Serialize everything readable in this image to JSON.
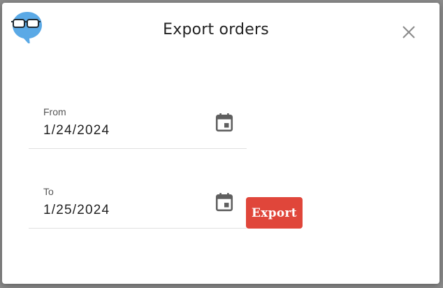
{
  "dialog": {
    "title": "Export orders",
    "close_icon": "close-icon",
    "logo_icon": "glasses-speech-bubble-logo"
  },
  "form": {
    "from": {
      "label": "From",
      "value": "1/24/2024",
      "icon": "calendar-icon"
    },
    "to": {
      "label": "To",
      "value": "1/25/2024",
      "icon": "calendar-icon"
    },
    "export_label": "Export"
  },
  "colors": {
    "export_button": "#e0463a",
    "logo_blue": "#5aa9e6",
    "overlay": "#8e8e8e"
  }
}
